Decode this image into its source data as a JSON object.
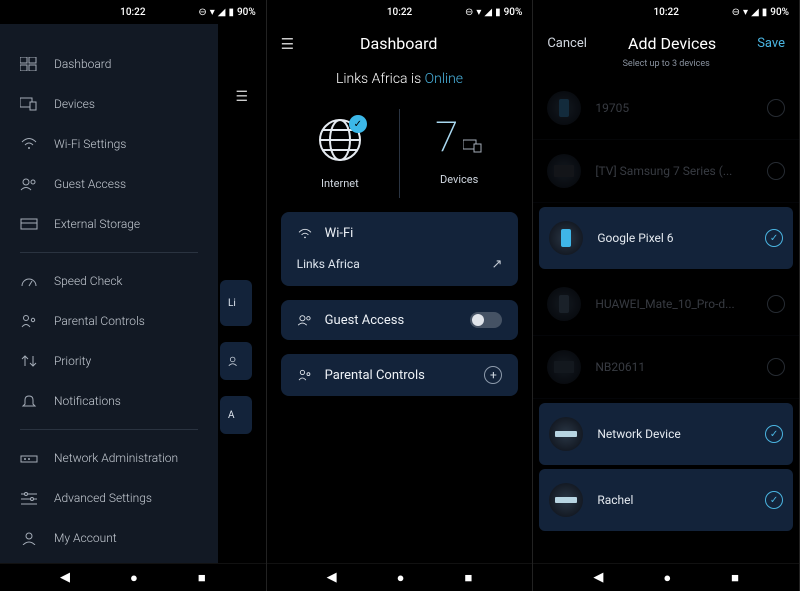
{
  "status": {
    "time": "10:22",
    "battery_pct": "90%"
  },
  "menu": {
    "dashboard": "Dashboard",
    "devices": "Devices",
    "wifi_settings": "Wi-Fi Settings",
    "guest_access": "Guest Access",
    "external_storage": "External Storage",
    "speed_check": "Speed Check",
    "parental_controls": "Parental Controls",
    "priority": "Priority",
    "notifications": "Notifications",
    "network_admin": "Network Administration",
    "advanced_settings": "Advanced Settings",
    "my_account": "My Account"
  },
  "dashboard": {
    "title": "Dashboard",
    "network_name": "Links Africa",
    "is_word": "is",
    "online": "Online",
    "internet_label": "Internet",
    "devices_label": "Devices",
    "devices_count": "7",
    "card_wifi": "Wi-Fi",
    "card_wifi_sub": "Links Africa",
    "card_guest": "Guest Access",
    "card_parental": "Parental Controls",
    "peek1": "Li",
    "peek3": "A"
  },
  "add_devices": {
    "cancel": "Cancel",
    "title": "Add Devices",
    "save": "Save",
    "subtitle": "Select up to 3 devices",
    "items": [
      {
        "name": "19705",
        "selected": false,
        "dim": true,
        "ico": "phone",
        "color": "#2b5f86"
      },
      {
        "name": "[TV] Samsung 7 Series (...",
        "selected": false,
        "dim": true,
        "ico": "tv",
        "color": "#2a2f38"
      },
      {
        "name": "Google Pixel 6",
        "selected": true,
        "dim": false,
        "ico": "phone",
        "color": "#3fb6e8"
      },
      {
        "name": "HUAWEI_Mate_10_Pro-d...",
        "selected": false,
        "dim": true,
        "ico": "phone",
        "color": "#3a4a5c"
      },
      {
        "name": "NB20611",
        "selected": false,
        "dim": true,
        "ico": "tv",
        "color": "#2a3644"
      },
      {
        "name": "Network Device",
        "selected": true,
        "dim": false,
        "ico": "bar",
        "color": "#b8d5e2"
      },
      {
        "name": "Rachel",
        "selected": true,
        "dim": false,
        "ico": "bar",
        "color": "#b8d5e2"
      }
    ]
  }
}
